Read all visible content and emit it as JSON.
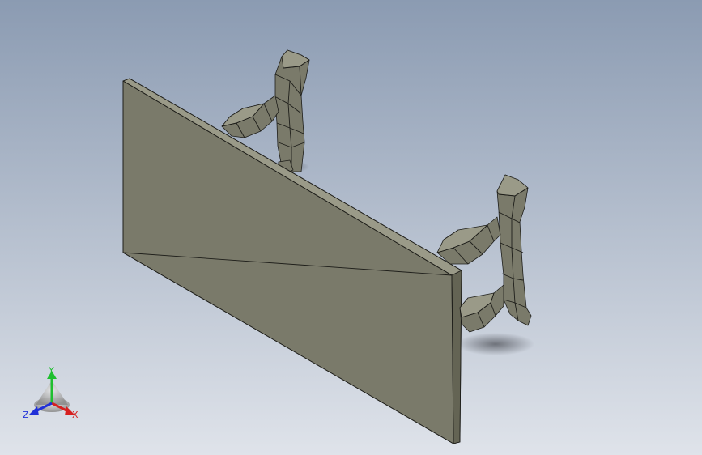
{
  "viewport": {
    "background_top": "#8b9bb2",
    "background_bottom": "#dfe3ea"
  },
  "model": {
    "face_color": "#7a7a6a",
    "edge_color": "#1e1e1a",
    "highlight_color": "#9a9a88"
  },
  "triad": {
    "x_label": "X",
    "y_label": "Y",
    "z_label": "Z",
    "x_color": "#d62020",
    "y_color": "#1fbf2f",
    "z_color": "#2030d8"
  }
}
